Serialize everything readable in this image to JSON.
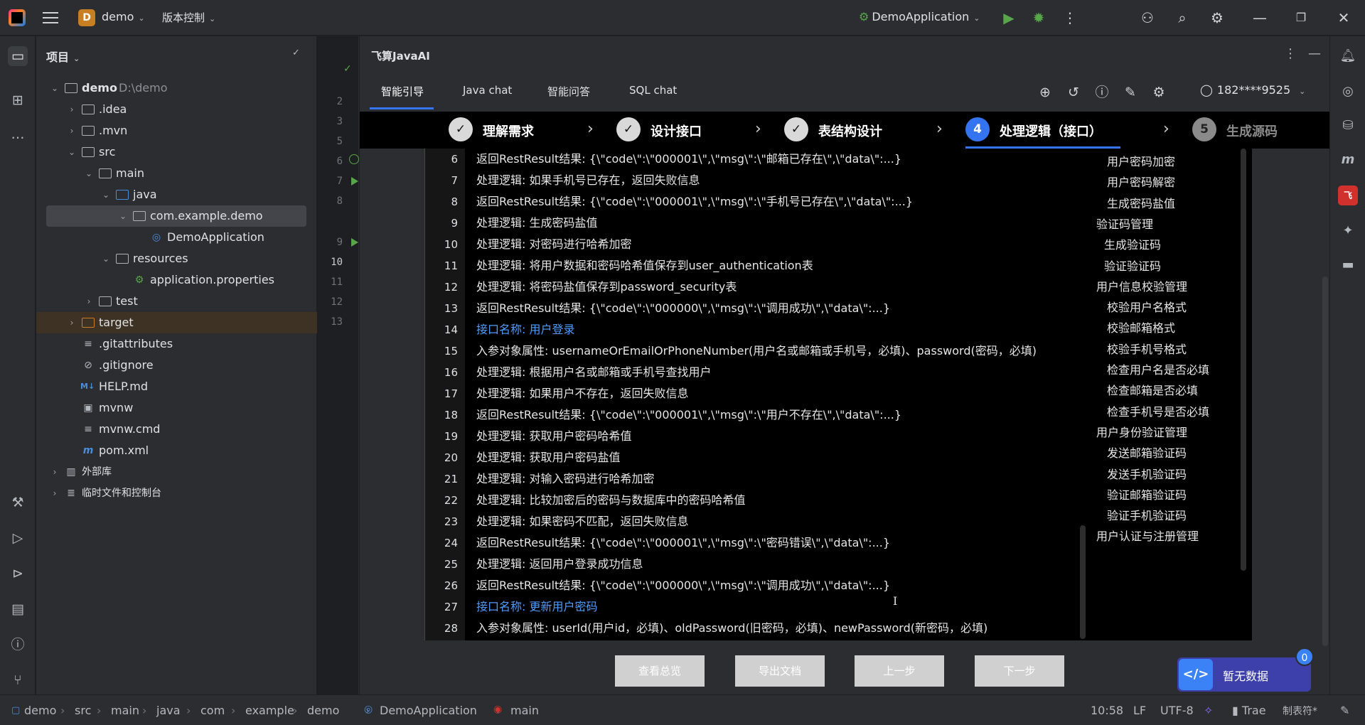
{
  "titlebar": {
    "project_initial": "D",
    "project_name": "demo",
    "vcs_label": "版本控制",
    "run_config": "DemoApplication"
  },
  "project_panel": {
    "title": "项目",
    "tree": [
      {
        "label": "demo",
        "extra": "D:\\demo",
        "kind": "root"
      },
      {
        "label": ".idea",
        "kind": "folder"
      },
      {
        "label": ".mvn",
        "kind": "folder"
      },
      {
        "label": "src",
        "kind": "folder"
      },
      {
        "label": "main",
        "kind": "folder"
      },
      {
        "label": "java",
        "kind": "folder"
      },
      {
        "label": "com.example.demo",
        "kind": "package"
      },
      {
        "label": "DemoApplication",
        "kind": "class"
      },
      {
        "label": "resources",
        "kind": "folder"
      },
      {
        "label": "application.properties",
        "kind": "file"
      },
      {
        "label": "test",
        "kind": "folder"
      },
      {
        "label": "target",
        "kind": "folder"
      },
      {
        "label": ".gitattributes",
        "kind": "file"
      },
      {
        "label": ".gitignore",
        "kind": "file"
      },
      {
        "label": "HELP.md",
        "kind": "file"
      },
      {
        "label": "mvnw",
        "kind": "file"
      },
      {
        "label": "mvnw.cmd",
        "kind": "file"
      },
      {
        "label": "pom.xml",
        "kind": "file"
      },
      {
        "label": "外部库",
        "kind": "library"
      },
      {
        "label": "临时文件和控制台",
        "kind": "scratch"
      }
    ]
  },
  "gutter": {
    "lines": [
      "2",
      "3",
      "5",
      "6",
      "7",
      "8",
      "9",
      "10",
      "11",
      "12",
      "13"
    ],
    "current_line": "10"
  },
  "plugin": {
    "title": "飞算JavaAI",
    "tabs": [
      "智能引导",
      "Java chat",
      "智能问答",
      "SQL chat"
    ],
    "active_tab": "智能引导",
    "user": "182****9525",
    "steps": [
      {
        "num": "✓",
        "label": "理解需求",
        "state": "done"
      },
      {
        "num": "✓",
        "label": "设计接口",
        "state": "done"
      },
      {
        "num": "✓",
        "label": "表结构设计",
        "state": "done"
      },
      {
        "num": "4",
        "label": "处理逻辑（接口）",
        "state": "current"
      },
      {
        "num": "5",
        "label": "生成源码",
        "state": "todo"
      }
    ],
    "code_lines": [
      {
        "n": "6",
        "text": "返回RestResult结果: {\\\"code\\\":\\\"000001\\\",\\\"msg\\\":\\\"邮箱已存在\\\",\\\"data\\\":...}",
        "style": "normal"
      },
      {
        "n": "7",
        "text": "处理逻辑: 如果手机号已存在，返回失败信息",
        "style": "normal"
      },
      {
        "n": "8",
        "text": "返回RestResult结果: {\\\"code\\\":\\\"000001\\\",\\\"msg\\\":\\\"手机号已存在\\\",\\\"data\\\":...}",
        "style": "normal"
      },
      {
        "n": "9",
        "text": "处理逻辑: 生成密码盐值",
        "style": "normal"
      },
      {
        "n": "10",
        "text": "处理逻辑: 对密码进行哈希加密",
        "style": "normal"
      },
      {
        "n": "11",
        "text": "处理逻辑: 将用户数据和密码哈希值保存到user_authentication表",
        "style": "normal"
      },
      {
        "n": "12",
        "text": "处理逻辑: 将密码盐值保存到password_security表",
        "style": "normal"
      },
      {
        "n": "13",
        "text": "返回RestResult结果: {\\\"code\\\":\\\"000000\\\",\\\"msg\\\":\\\"调用成功\\\",\\\"data\\\":...}",
        "style": "normal"
      },
      {
        "n": "14",
        "text": "接口名称: 用户登录",
        "style": "blue"
      },
      {
        "n": "15",
        "text": "入参对象属性: usernameOrEmailOrPhoneNumber(用户名或邮箱或手机号，必填)、password(密码，必填)",
        "style": "normal"
      },
      {
        "n": "16",
        "text": "处理逻辑: 根据用户名或邮箱或手机号查找用户",
        "style": "normal"
      },
      {
        "n": "17",
        "text": "处理逻辑: 如果用户不存在，返回失败信息",
        "style": "normal"
      },
      {
        "n": "18",
        "text": "返回RestResult结果: {\\\"code\\\":\\\"000001\\\",\\\"msg\\\":\\\"用户不存在\\\",\\\"data\\\":...}",
        "style": "normal"
      },
      {
        "n": "19",
        "text": "处理逻辑: 获取用户密码哈希值",
        "style": "normal"
      },
      {
        "n": "20",
        "text": "处理逻辑: 获取用户密码盐值",
        "style": "normal"
      },
      {
        "n": "21",
        "text": "处理逻辑: 对输入密码进行哈希加密",
        "style": "normal"
      },
      {
        "n": "22",
        "text": "处理逻辑: 比较加密后的密码与数据库中的密码哈希值",
        "style": "normal"
      },
      {
        "n": "23",
        "text": "处理逻辑: 如果密码不匹配，返回失败信息",
        "style": "normal"
      },
      {
        "n": "24",
        "text": "返回RestResult结果: {\\\"code\\\":\\\"000001\\\",\\\"msg\\\":\\\"密码错误\\\",\\\"data\\\":...}",
        "style": "normal"
      },
      {
        "n": "25",
        "text": "处理逻辑: 返回用户登录成功信息",
        "style": "normal"
      },
      {
        "n": "26",
        "text": "返回RestResult结果: {\\\"code\\\":\\\"000000\\\",\\\"msg\\\":\\\"调用成功\\\",\\\"data\\\":...}",
        "style": "normal"
      },
      {
        "n": "27",
        "text": "接口名称: 更新用户密码",
        "style": "blue"
      },
      {
        "n": "28",
        "text": "入参对象属性: userId(用户id，必填)、oldPassword(旧密码，必填)、newPassword(新密码，必填)",
        "style": "normal"
      }
    ],
    "outline": [
      {
        "label": "用户密码加密",
        "level": 2
      },
      {
        "label": "用户密码解密",
        "level": 2
      },
      {
        "label": "生成密码盐值",
        "level": 2
      },
      {
        "label": "验证码管理",
        "level": 1
      },
      {
        "label": "生成验证码",
        "level": 2
      },
      {
        "label": "验证验证码",
        "level": 2
      },
      {
        "label": "用户信息校验管理",
        "level": 1
      },
      {
        "label": "校验用户名格式",
        "level": 2
      },
      {
        "label": "校验邮箱格式",
        "level": 2
      },
      {
        "label": "校验手机号格式",
        "level": 2
      },
      {
        "label": "检查用户名是否必填",
        "level": 2
      },
      {
        "label": "检查邮箱是否必填",
        "level": 2
      },
      {
        "label": "检查手机号是否必填",
        "level": 2
      },
      {
        "label": "用户身份验证管理",
        "level": 1
      },
      {
        "label": "发送邮箱验证码",
        "level": 2
      },
      {
        "label": "发送手机验证码",
        "level": 2
      },
      {
        "label": "验证邮箱验证码",
        "level": 2
      },
      {
        "label": "验证手机验证码",
        "level": 2
      },
      {
        "label": "用户认证与注册管理",
        "level": 1
      }
    ],
    "buttons": {
      "overview": "查看总览",
      "export": "导出文档",
      "prev": "上一步",
      "next": "下一步"
    },
    "nodata": {
      "label": "暂无数据",
      "count": "0",
      "icon_text": "</>"
    }
  },
  "statusbar": {
    "breadcrumb": [
      "demo",
      "src",
      "main",
      "java",
      "com",
      "example",
      "demo",
      "DemoApplication",
      "main"
    ],
    "position": "10:58",
    "line_sep": "LF",
    "encoding": "UTF-8",
    "ai": "Trae",
    "indent": "制表符*"
  },
  "colors": {
    "accent": "#3574f0",
    "link_blue": "#4e9cff",
    "run_green": "#57a64a"
  }
}
